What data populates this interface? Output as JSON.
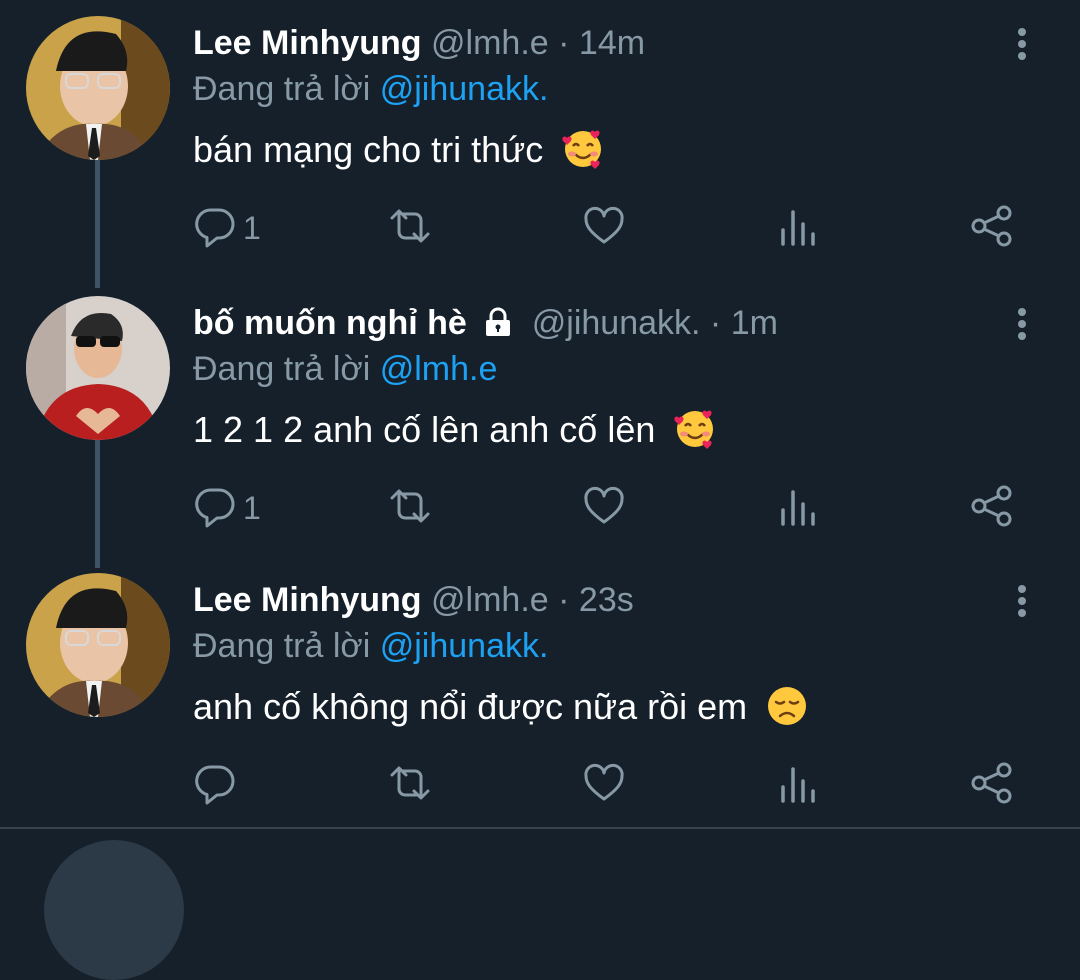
{
  "tweets": [
    {
      "author": "Lee Minhyung",
      "handle": "@lmh.e",
      "dot": "·",
      "time": "14m",
      "reply_prefix": "Đang trả lời",
      "reply_to": "@jihunakk.",
      "text": "bán mạng cho tri thức",
      "emoji": "smiling-face-with-hearts",
      "reply_count": "1",
      "locked": false
    },
    {
      "author": "bố muốn nghỉ hè",
      "handle": "@jihunakk.",
      "dot": "·",
      "time": "1m",
      "reply_prefix": "Đang trả lời",
      "reply_to": "@lmh.e",
      "text": "1 2 1 2 anh cố lên anh cố lên",
      "emoji": "smiling-face-with-hearts",
      "reply_count": "1",
      "locked": true
    },
    {
      "author": "Lee Minhyung",
      "handle": "@lmh.e",
      "dot": "·",
      "time": "23s",
      "reply_prefix": "Đang trả lời",
      "reply_to": "@jihunakk.",
      "text": "anh cố không nổi được nữa rồi em",
      "emoji": "disappointed-face",
      "reply_count": "",
      "locked": false
    }
  ],
  "icons": {
    "reply": "reply-icon",
    "retweet": "retweet-icon",
    "like": "heart-icon",
    "analytics": "analytics-icon",
    "share": "share-icon",
    "more": "more-vertical-icon",
    "lock": "lock-icon"
  },
  "colors": {
    "background": "#15202b",
    "mention": "#1da1f2",
    "secondary_text": "#8899a6",
    "thread_line": "#3d5466"
  }
}
